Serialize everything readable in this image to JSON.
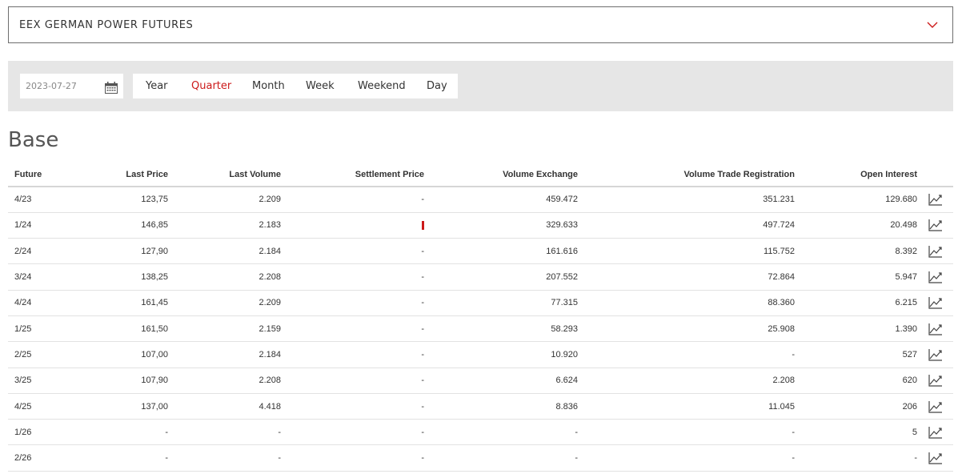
{
  "header": {
    "title": "EEX GERMAN POWER FUTURES",
    "chevron_icon": "chevron-down-icon"
  },
  "filters": {
    "date": "2023-07-27",
    "calendar_icon": "calendar-icon",
    "tabs": [
      {
        "label": "Year",
        "active": false
      },
      {
        "label": "Quarter",
        "active": true
      },
      {
        "label": "Month",
        "active": false
      },
      {
        "label": "Week",
        "active": false
      },
      {
        "label": "Weekend",
        "active": false
      },
      {
        "label": "Day",
        "active": false
      }
    ]
  },
  "section": {
    "title": "Base"
  },
  "table": {
    "columns": [
      "Future",
      "Last Price",
      "Last Volume",
      "Settlement Price",
      "Volume Exchange",
      "Volume Trade Registration",
      "Open Interest"
    ],
    "rows": [
      [
        "4/23",
        "123,75",
        "2.209",
        "-",
        "459.472",
        "351.231",
        "129.680"
      ],
      [
        "1/24",
        "146,85",
        "2.183",
        "",
        "329.633",
        "497.724",
        "20.498"
      ],
      [
        "2/24",
        "127,90",
        "2.184",
        "-",
        "161.616",
        "115.752",
        "8.392"
      ],
      [
        "3/24",
        "138,25",
        "2.208",
        "-",
        "207.552",
        "72.864",
        "5.947"
      ],
      [
        "4/24",
        "161,45",
        "2.209",
        "-",
        "77.315",
        "88.360",
        "6.215"
      ],
      [
        "1/25",
        "161,50",
        "2.159",
        "-",
        "58.293",
        "25.908",
        "1.390"
      ],
      [
        "2/25",
        "107,00",
        "2.184",
        "-",
        "10.920",
        "-",
        "527"
      ],
      [
        "3/25",
        "107,90",
        "2.208",
        "-",
        "6.624",
        "2.208",
        "620"
      ],
      [
        "4/25",
        "137,00",
        "4.418",
        "-",
        "8.836",
        "11.045",
        "206"
      ],
      [
        "1/26",
        "-",
        "-",
        "-",
        "-",
        "-",
        "5"
      ],
      [
        "2/26",
        "-",
        "-",
        "-",
        "-",
        "-",
        "-"
      ]
    ],
    "settlement_marker_row": 1,
    "chart_icon": "line-chart-icon"
  },
  "colors": {
    "accent": "#cc1a1a",
    "filter_bg": "#e6e6e6",
    "text": "#333333"
  }
}
